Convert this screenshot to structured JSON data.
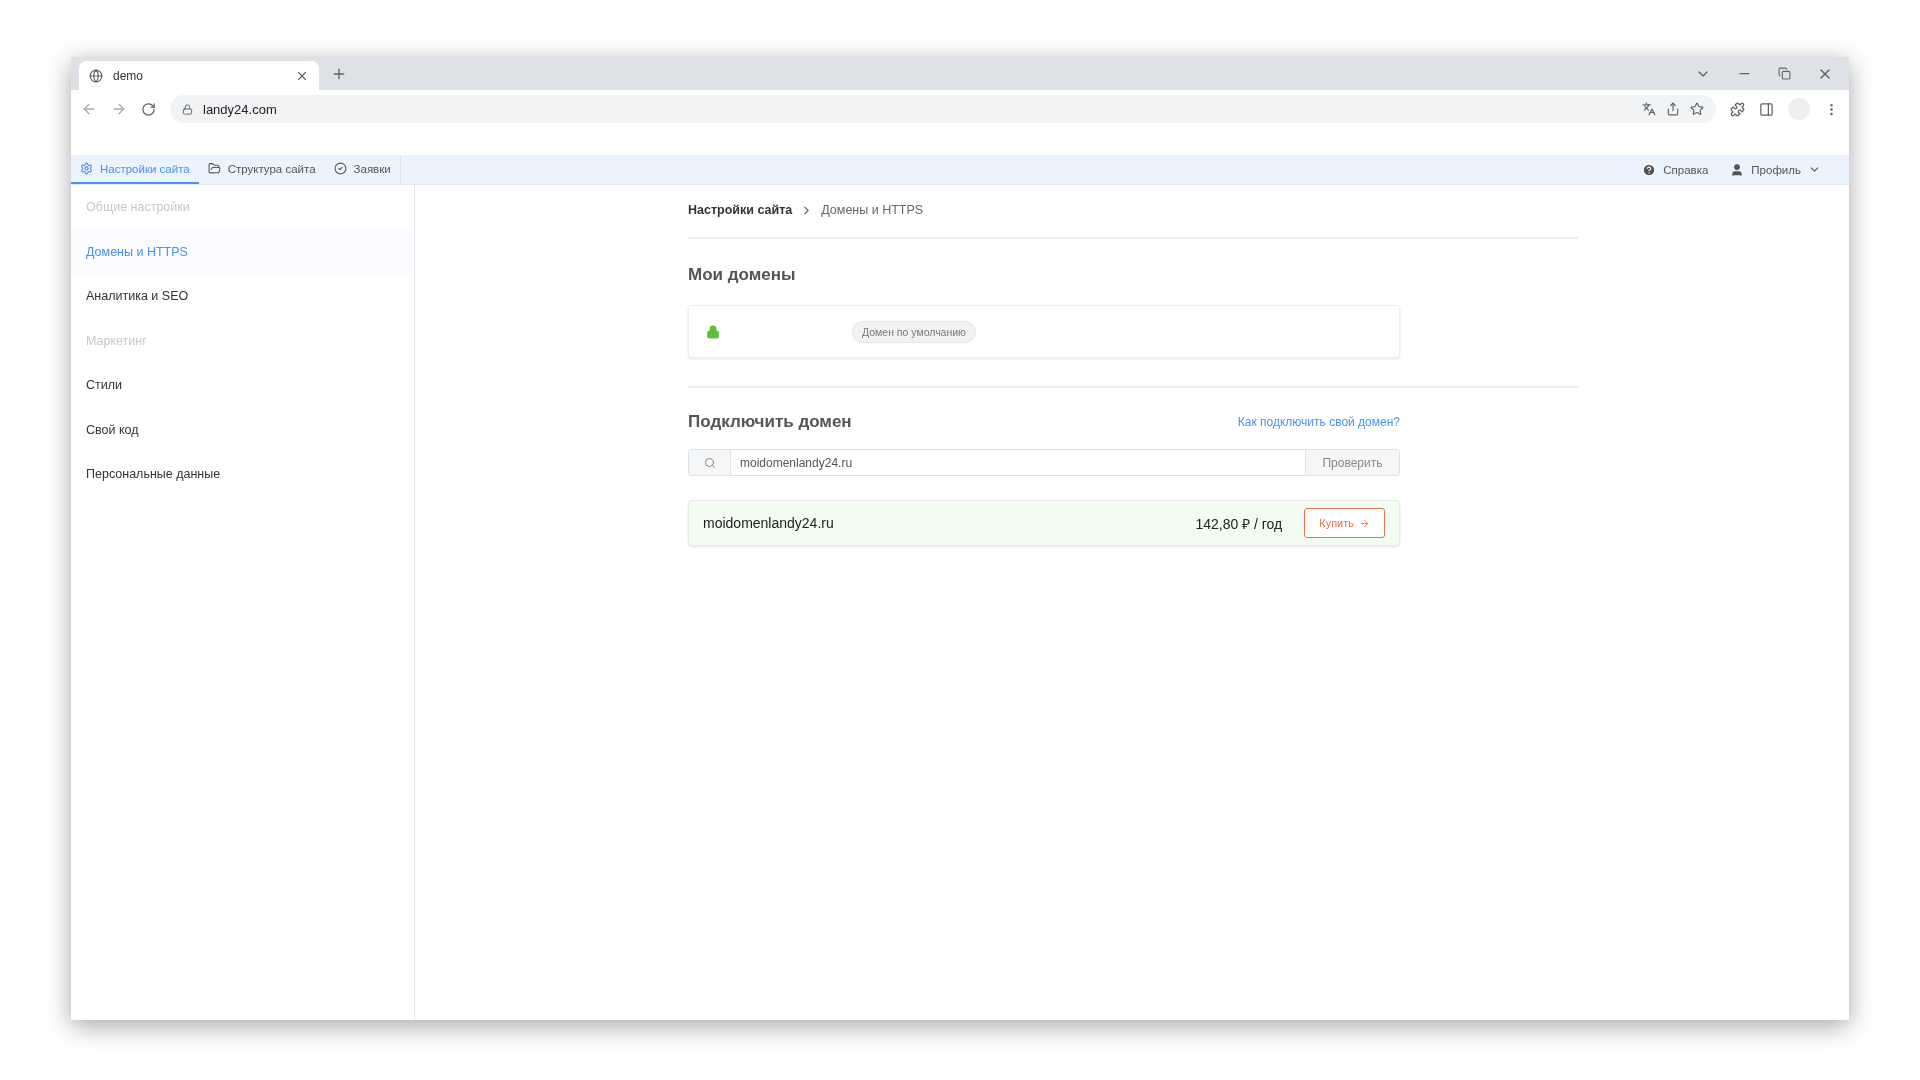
{
  "browser": {
    "tab_title": "demo",
    "url": "landy24.com"
  },
  "app_nav": {
    "tabs": [
      {
        "label": "Настройки сайта",
        "selected": true
      },
      {
        "label": "Структура сайта",
        "selected": false
      },
      {
        "label": "Заявки",
        "selected": false
      }
    ],
    "help": "Справка",
    "profile": "Профиль"
  },
  "sidebar": {
    "items": [
      {
        "label": "Общие настройки",
        "selected": false,
        "disabled": true
      },
      {
        "label": "Домены и HTTPS",
        "selected": true,
        "disabled": false
      },
      {
        "label": "Аналитика и SEO",
        "selected": false,
        "disabled": false
      },
      {
        "label": "Маркетинг",
        "selected": false,
        "disabled": true
      },
      {
        "label": "Стили",
        "selected": false,
        "disabled": false
      },
      {
        "label": "Свой код",
        "selected": false,
        "disabled": false
      },
      {
        "label": "Персональные данные",
        "selected": false,
        "disabled": false
      }
    ]
  },
  "breadcrumb": [
    "Настройки сайта",
    "Домены и HTTPS"
  ],
  "my_domains": {
    "title": "Мои домены",
    "domains": [
      {
        "secure": true,
        "badge": "Домен по умолчанию"
      }
    ]
  },
  "connect": {
    "title": "Подключить домен",
    "help_link": "Как подключить свой домен?",
    "search": {
      "value": "moidomenlandy24.ru",
      "button": "Проверить"
    },
    "result": {
      "domain": "moidomenlandy24.ru",
      "price": "142,80 ₽ / год",
      "buy": "Купить"
    }
  }
}
